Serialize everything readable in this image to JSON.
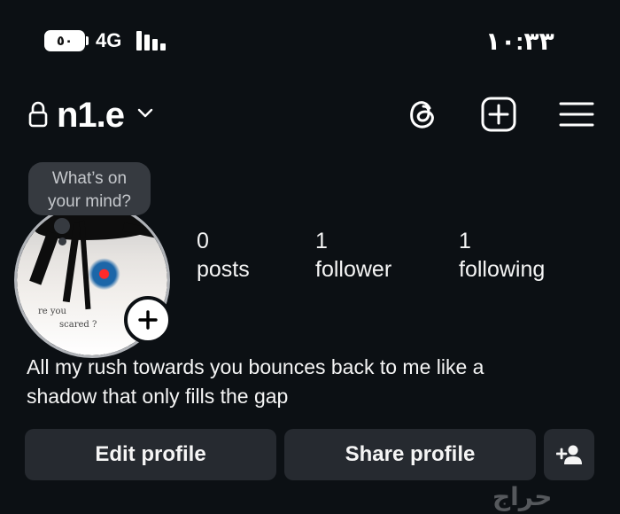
{
  "status_bar": {
    "battery": "٥٠",
    "network": "4G",
    "time": "١٠:٣٣"
  },
  "header": {
    "username": "n1.e",
    "icons": [
      "lock-icon",
      "chevron-down-icon",
      "threads-icon",
      "new-post-icon",
      "menu-icon"
    ]
  },
  "note_bubble": {
    "line1": "What’s on",
    "line2": "your mind?"
  },
  "avatar": {
    "caption_line1": "re you",
    "caption_line2": "scared ?"
  },
  "stats": [
    {
      "value": "0",
      "label": "posts"
    },
    {
      "value": "1",
      "label": "follower"
    },
    {
      "value": "1",
      "label": "following"
    }
  ],
  "bio": {
    "line1": "All my rush towards you bounces back to me like a",
    "line2": "shadow that only fills the gap"
  },
  "buttons": {
    "edit": "Edit profile",
    "share": "Share profile",
    "discover_icon": "add-person-icon"
  },
  "watermark": "حراج",
  "colors": {
    "background": "#0c1014",
    "button": "#262a30",
    "bubble": "#363a40"
  }
}
